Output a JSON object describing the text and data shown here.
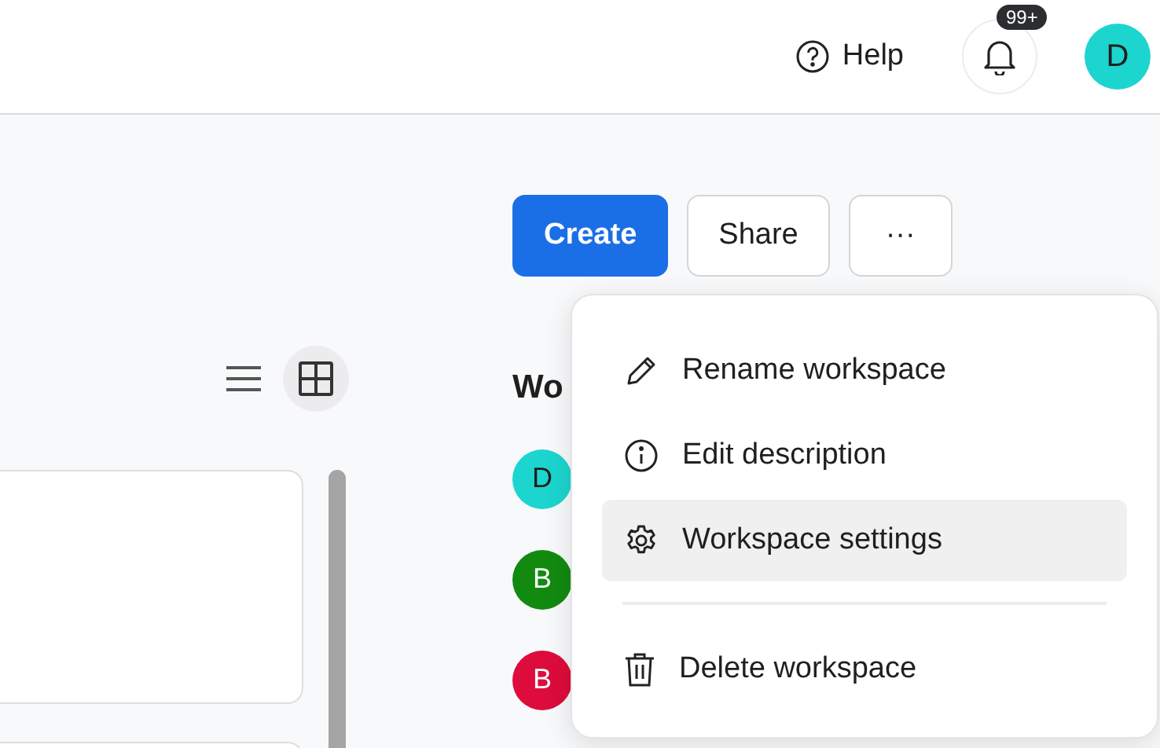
{
  "header": {
    "help": "Help",
    "notification_badge": "99+",
    "user_initial": "D"
  },
  "toolbar": {
    "buttons": [
      "Create",
      "Share",
      "···"
    ]
  },
  "view_toggle": [
    {
      "kind": "list",
      "selected": false
    },
    {
      "kind": "grid",
      "selected": true
    }
  ],
  "members": {
    "heading": "Wo",
    "items": [
      {
        "initial": "D",
        "color": "#1cd5cf"
      },
      {
        "initial": "B",
        "color": "#128a10"
      },
      {
        "initial": "B",
        "color": "#dd0c3c"
      }
    ]
  },
  "menu": {
    "groups": [
      [
        {
          "label": "Rename workspace",
          "selected": false
        },
        {
          "label": "Edit description",
          "selected": false
        },
        {
          "label": "Workspace settings",
          "selected": true
        }
      ],
      [
        {
          "label": "Delete workspace",
          "selected": false
        }
      ]
    ]
  }
}
